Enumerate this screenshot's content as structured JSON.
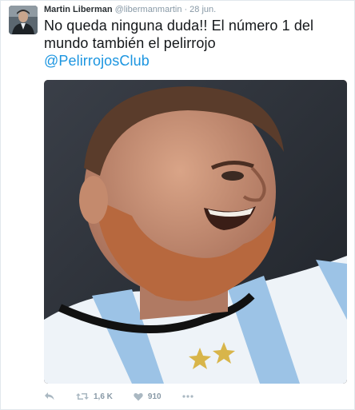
{
  "tweet": {
    "author_name": "Martin Liberman",
    "author_handle": "@libermanmartin",
    "separator": "·",
    "timestamp": "28 jun.",
    "text": "No queda ninguna duda!! El número 1 del mundo también el pelirrojo",
    "mention": "@PelirrojosClub"
  },
  "actions": {
    "reply_icon": "reply-icon",
    "retweet_icon": "retweet-icon",
    "retweet_count": "1,6 K",
    "like_icon": "heart-icon",
    "like_count": "910",
    "more_icon": "more-icon"
  },
  "colors": {
    "link": "#1b95e0",
    "muted": "#8899a6",
    "text": "#14171a"
  }
}
